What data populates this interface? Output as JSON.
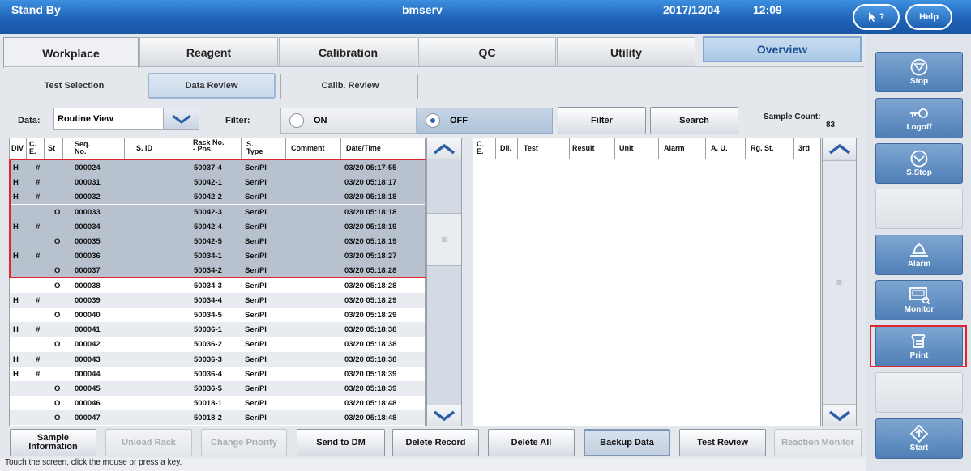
{
  "titlebar": {
    "status": "Stand By",
    "user": "bmserv",
    "date": "2017/12/04",
    "time": "12:09",
    "help_context_label": "?",
    "help_label": "Help"
  },
  "tabs": [
    "Workplace",
    "Reagent",
    "Calibration",
    "QC",
    "Utility",
    "Overview"
  ],
  "active_tab": "Workplace",
  "subtabs": [
    "Test Selection",
    "Data Review",
    "Calib. Review"
  ],
  "active_subtab": "Data Review",
  "controls": {
    "data_label": "Data:",
    "data_value": "Routine View",
    "filter_label": "Filter:",
    "on_label": "ON",
    "off_label": "OFF",
    "filter_selected": "OFF",
    "filter_button": "Filter",
    "search_button": "Search",
    "sample_count_label": "Sample Count:",
    "sample_count": "83"
  },
  "left_table": {
    "headers": [
      "DIV",
      "C. E.",
      "St",
      "Seq. No.",
      "S. ID",
      "Rack No. - Pos.",
      "S. Type",
      "Comment",
      "Date/Time"
    ],
    "rows": [
      {
        "div": "H",
        "ce": "#",
        "st": "",
        "seq": "000024",
        "sid": "",
        "rack": "50037-4",
        "stype": "Ser/Pl",
        "comment": "",
        "dt": "03/20 05:17:55"
      },
      {
        "div": "H",
        "ce": "#",
        "st": "",
        "seq": "000031",
        "sid": "",
        "rack": "50042-1",
        "stype": "Ser/Pl",
        "comment": "",
        "dt": "03/20 05:18:17"
      },
      {
        "div": "H",
        "ce": "#",
        "st": "",
        "seq": "000032",
        "sid": "",
        "rack": "50042-2",
        "stype": "Ser/Pl",
        "comment": "",
        "dt": "03/20 05:18:18"
      },
      {
        "div": "",
        "ce": "",
        "st": "O",
        "seq": "000033",
        "sid": "",
        "rack": "50042-3",
        "stype": "Ser/Pl",
        "comment": "",
        "dt": "03/20 05:18:18"
      },
      {
        "div": "H",
        "ce": "#",
        "st": "",
        "seq": "000034",
        "sid": "",
        "rack": "50042-4",
        "stype": "Ser/Pl",
        "comment": "",
        "dt": "03/20 05:18:19"
      },
      {
        "div": "",
        "ce": "",
        "st": "O",
        "seq": "000035",
        "sid": "",
        "rack": "50042-5",
        "stype": "Ser/Pl",
        "comment": "",
        "dt": "03/20 05:18:19"
      },
      {
        "div": "H",
        "ce": "#",
        "st": "",
        "seq": "000036",
        "sid": "",
        "rack": "50034-1",
        "stype": "Ser/Pl",
        "comment": "",
        "dt": "03/20 05:18:27"
      },
      {
        "div": "",
        "ce": "",
        "st": "O",
        "seq": "000037",
        "sid": "",
        "rack": "50034-2",
        "stype": "Ser/Pl",
        "comment": "",
        "dt": "03/20 05:18:28"
      },
      {
        "div": "",
        "ce": "",
        "st": "O",
        "seq": "000038",
        "sid": "",
        "rack": "50034-3",
        "stype": "Ser/Pl",
        "comment": "",
        "dt": "03/20 05:18:28"
      },
      {
        "div": "H",
        "ce": "#",
        "st": "",
        "seq": "000039",
        "sid": "",
        "rack": "50034-4",
        "stype": "Ser/Pl",
        "comment": "",
        "dt": "03/20 05:18:29"
      },
      {
        "div": "",
        "ce": "",
        "st": "O",
        "seq": "000040",
        "sid": "",
        "rack": "50034-5",
        "stype": "Ser/Pl",
        "comment": "",
        "dt": "03/20 05:18:29"
      },
      {
        "div": "H",
        "ce": "#",
        "st": "",
        "seq": "000041",
        "sid": "",
        "rack": "50036-1",
        "stype": "Ser/Pl",
        "comment": "",
        "dt": "03/20 05:18:38"
      },
      {
        "div": "",
        "ce": "",
        "st": "O",
        "seq": "000042",
        "sid": "",
        "rack": "50036-2",
        "stype": "Ser/Pl",
        "comment": "",
        "dt": "03/20 05:18:38"
      },
      {
        "div": "H",
        "ce": "#",
        "st": "",
        "seq": "000043",
        "sid": "",
        "rack": "50036-3",
        "stype": "Ser/Pl",
        "comment": "",
        "dt": "03/20 05:18:38"
      },
      {
        "div": "H",
        "ce": "#",
        "st": "",
        "seq": "000044",
        "sid": "",
        "rack": "50036-4",
        "stype": "Ser/Pl",
        "comment": "",
        "dt": "03/20 05:18:39"
      },
      {
        "div": "",
        "ce": "",
        "st": "O",
        "seq": "000045",
        "sid": "",
        "rack": "50036-5",
        "stype": "Ser/Pl",
        "comment": "",
        "dt": "03/20 05:18:39"
      },
      {
        "div": "",
        "ce": "",
        "st": "O",
        "seq": "000046",
        "sid": "",
        "rack": "50018-1",
        "stype": "Ser/Pl",
        "comment": "",
        "dt": "03/20 05:18:48"
      },
      {
        "div": "",
        "ce": "",
        "st": "O",
        "seq": "000047",
        "sid": "",
        "rack": "50018-2",
        "stype": "Ser/Pl",
        "comment": "",
        "dt": "03/20 05:18:48"
      }
    ]
  },
  "right_table": {
    "headers": [
      "C. E.",
      "Dil.",
      "Test",
      "Result",
      "Unit",
      "Alarm",
      "A. U.",
      "Rg. St.",
      "3rd"
    ]
  },
  "bottom_buttons": [
    {
      "label": "Sample Information",
      "enabled": true,
      "pressed": false
    },
    {
      "label": "Unload Rack",
      "enabled": false,
      "pressed": false
    },
    {
      "label": "Change Priority",
      "enabled": false,
      "pressed": false
    },
    {
      "label": "Send to DM",
      "enabled": true,
      "pressed": false
    },
    {
      "label": "Delete Record",
      "enabled": true,
      "pressed": false
    },
    {
      "label": "Delete All",
      "enabled": true,
      "pressed": false
    },
    {
      "label": "Backup Data",
      "enabled": true,
      "pressed": true
    },
    {
      "label": "Test Review",
      "enabled": true,
      "pressed": false
    },
    {
      "label": "Reaction Monitor",
      "enabled": false,
      "pressed": false
    }
  ],
  "sidebar": [
    {
      "label": "Stop",
      "icon": "stop-icon"
    },
    {
      "label": "Logoff",
      "icon": "key-icon"
    },
    {
      "label": "S.Stop",
      "icon": "sampling-stop-icon"
    },
    {
      "label": "",
      "icon": ""
    },
    {
      "label": "Alarm",
      "icon": "bell-icon"
    },
    {
      "label": "Monitor",
      "icon": "monitor-icon"
    },
    {
      "label": "Print",
      "icon": "printer-icon"
    },
    {
      "label": "",
      "icon": ""
    },
    {
      "label": "Start",
      "icon": "start-icon"
    }
  ],
  "footer": "Touch the screen, click the mouse or press a key.",
  "colors": {
    "titlebar": "#1f63b8",
    "sidebar_button": "#5f8dc2",
    "selected_row": "#b8c2cf",
    "highlight": "#e0262c"
  }
}
